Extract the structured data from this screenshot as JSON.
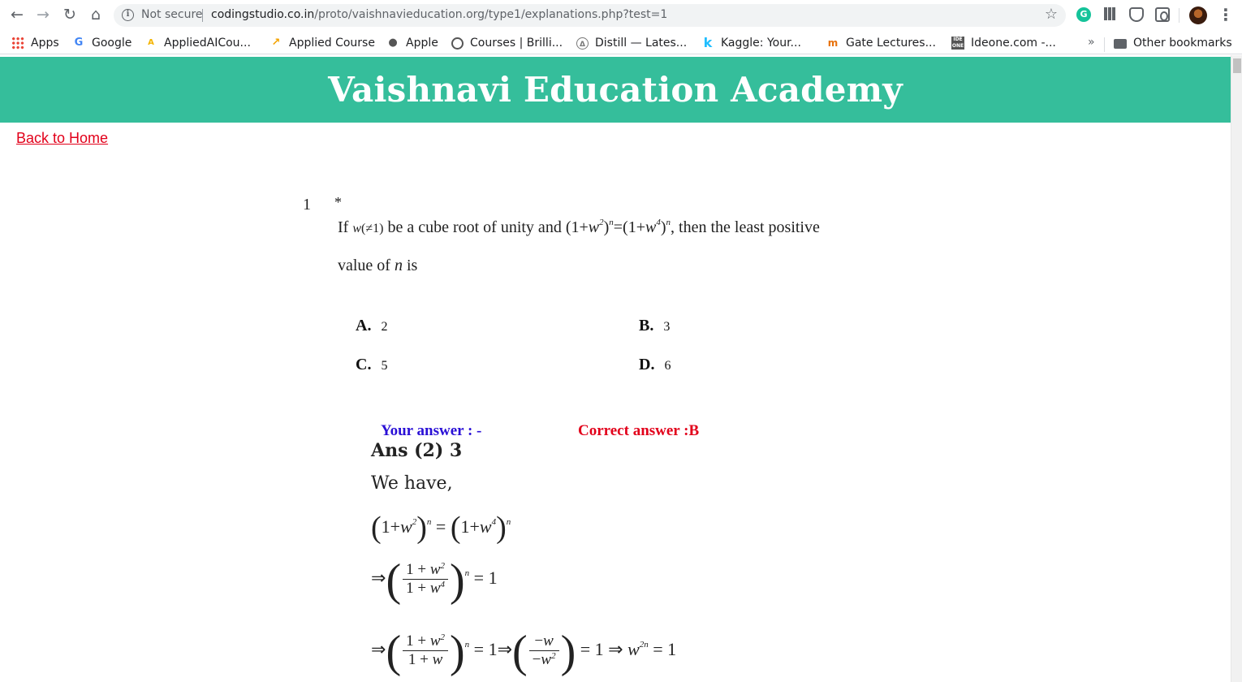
{
  "browser": {
    "security_label": "Not secure",
    "url_host": "codingstudio.co.in",
    "url_path": "/proto/vaishnavieducation.org/type1/explanations.php?test=1",
    "bookmarks": [
      {
        "label": "Apps"
      },
      {
        "label": "Google"
      },
      {
        "label": "AppliedAICou..."
      },
      {
        "label": "Applied Course"
      },
      {
        "label": "Apple"
      },
      {
        "label": "Courses | Brilli..."
      },
      {
        "label": "Distill — Lates..."
      },
      {
        "label": "Kaggle: Your..."
      },
      {
        "label": "Gate Lectures..."
      },
      {
        "label": "Ideone.com -..."
      }
    ],
    "more_bookmarks": "»",
    "other_bookmarks": "Other bookmarks"
  },
  "site": {
    "title": "Vaishnavi Education Academy",
    "back_link": "Back to Home"
  },
  "question": {
    "number": "1",
    "marker": "*",
    "text_if": "If",
    "text_cube_root": "be a cube root of unity and",
    "text_then": ", then the least positive",
    "text_value_of": "value of",
    "text_is": "is",
    "options": [
      {
        "letter": "A.",
        "value": "2"
      },
      {
        "letter": "B.",
        "value": "3"
      },
      {
        "letter": "C.",
        "value": "5"
      },
      {
        "letter": "D.",
        "value": "6"
      }
    ]
  },
  "result": {
    "your_answer": "Your answer : -",
    "correct_answer": "Correct answer :B"
  },
  "solution": {
    "answer_line": "Ans (2) 3",
    "intro": "We have,"
  },
  "colors": {
    "header_bg": "#35be9b",
    "link": "#e2001a",
    "your_answer": "#2a10d6",
    "correct_answer": "#e2001a"
  },
  "icons": [
    "back-arrow-icon",
    "forward-arrow-icon",
    "reload-icon",
    "home-icon",
    "info-icon",
    "star-icon",
    "grammarly-icon",
    "profile-avatar",
    "menu-icon",
    "folder-icon"
  ]
}
